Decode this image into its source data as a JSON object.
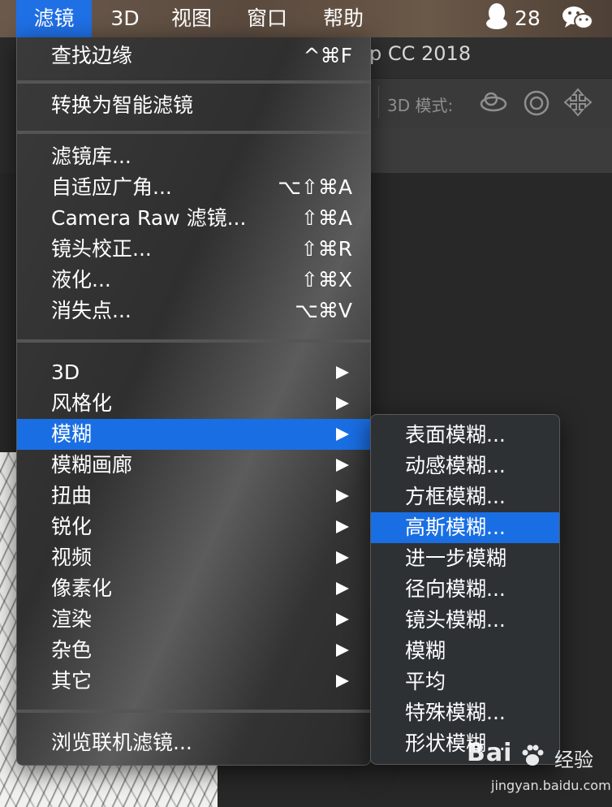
{
  "menubar": {
    "items": [
      {
        "label": "滤镜",
        "active": true
      },
      {
        "label": "3D",
        "active": false
      },
      {
        "label": "视图",
        "active": false
      },
      {
        "label": "窗口",
        "active": false
      },
      {
        "label": "帮助",
        "active": false
      }
    ],
    "qq_count": "28",
    "qq_icon": "qq-penguin-icon",
    "wechat_icon": "wechat-icon"
  },
  "photoshop": {
    "title_fragment": "p CC 2018",
    "options": {
      "mode_label": "3D 模式:",
      "icons": [
        "orbit-3d-icon",
        "roll-3d-icon",
        "pan-3d-icon"
      ]
    }
  },
  "filter_menu": {
    "groups": [
      [
        {
          "label": "查找边缘",
          "shortcut": "^⌘F"
        }
      ],
      [
        {
          "label": "转换为智能滤镜",
          "shortcut": ""
        }
      ],
      [
        {
          "label": "滤镜库...",
          "shortcut": ""
        },
        {
          "label": "自适应广角...",
          "shortcut": "⌥⇧⌘A"
        },
        {
          "label": "Camera Raw 滤镜...",
          "shortcut": "⇧⌘A"
        },
        {
          "label": "镜头校正...",
          "shortcut": "⇧⌘R"
        },
        {
          "label": "液化...",
          "shortcut": "⇧⌘X"
        },
        {
          "label": "消失点...",
          "shortcut": "⌥⌘V"
        }
      ],
      [
        {
          "label": "3D",
          "submenu": true
        },
        {
          "label": "风格化",
          "submenu": true
        },
        {
          "label": "模糊",
          "submenu": true,
          "highlighted": true
        },
        {
          "label": "模糊画廊",
          "submenu": true
        },
        {
          "label": "扭曲",
          "submenu": true
        },
        {
          "label": "锐化",
          "submenu": true
        },
        {
          "label": "视频",
          "submenu": true
        },
        {
          "label": "像素化",
          "submenu": true
        },
        {
          "label": "渲染",
          "submenu": true
        },
        {
          "label": "杂色",
          "submenu": true
        },
        {
          "label": "其它",
          "submenu": true
        }
      ],
      [
        {
          "label": "浏览联机滤镜...",
          "shortcut": ""
        }
      ]
    ]
  },
  "blur_submenu": {
    "items": [
      {
        "label": "表面模糊..."
      },
      {
        "label": "动感模糊..."
      },
      {
        "label": "方框模糊..."
      },
      {
        "label": "高斯模糊...",
        "highlighted": true
      },
      {
        "label": "进一步模糊"
      },
      {
        "label": "径向模糊..."
      },
      {
        "label": "镜头模糊..."
      },
      {
        "label": "模糊"
      },
      {
        "label": "平均"
      },
      {
        "label": "特殊模糊..."
      },
      {
        "label": "形状模糊..."
      }
    ]
  },
  "watermark": {
    "logo": "Bai",
    "text": "经验",
    "url": "jingyan.baidu.com"
  },
  "colors": {
    "highlight": "#1a6ee3",
    "menubar_active": "#1f6fe5"
  }
}
